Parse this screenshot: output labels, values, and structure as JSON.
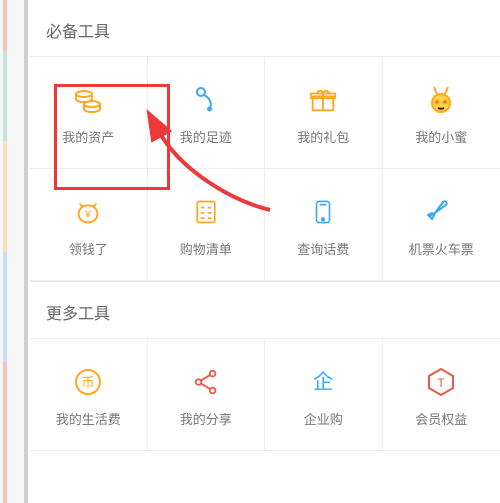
{
  "sections": [
    {
      "title": "必备工具",
      "items": [
        {
          "label": "我的资产",
          "icon": "coins-icon"
        },
        {
          "label": "我的足迹",
          "icon": "footprint-icon"
        },
        {
          "label": "我的礼包",
          "icon": "gift-icon"
        },
        {
          "label": "我的小蜜",
          "icon": "bee-icon"
        },
        {
          "label": "领钱了",
          "icon": "cat-coin-icon"
        },
        {
          "label": "购物清单",
          "icon": "checklist-icon"
        },
        {
          "label": "查询话费",
          "icon": "phone-bill-icon"
        },
        {
          "label": "机票火车票",
          "icon": "plane-icon"
        }
      ]
    },
    {
      "title": "更多工具",
      "items": [
        {
          "label": "我的生活费",
          "icon": "coin-bi-icon"
        },
        {
          "label": "我的分享",
          "icon": "share-icon"
        },
        {
          "label": "企业购",
          "icon": "enterprise-icon"
        },
        {
          "label": "会员权益",
          "icon": "member-icon"
        }
      ]
    }
  ],
  "colors": {
    "orange": "#ffa81d",
    "blue": "#3aa9f2",
    "red": "#ec5a4a"
  }
}
